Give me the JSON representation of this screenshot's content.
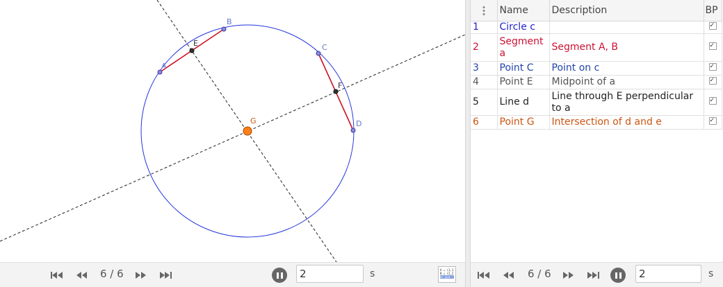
{
  "colors": {
    "blue": "#2222cc",
    "red": "#cc1133",
    "navy": "#2244aa",
    "gray": "#555555",
    "black": "#222222",
    "orange": "#cc5511",
    "circle": "#2233dd",
    "segment": "#cc1122",
    "point_g": "#ff7f1a"
  },
  "graphics": {
    "labels": {
      "A": "A",
      "B": "B",
      "C": "C",
      "D": "D",
      "E": "E",
      "F": "F",
      "G": "G"
    }
  },
  "protocol": {
    "headers": {
      "num": "",
      "name": "Name",
      "description": "Description",
      "bp": "BP"
    },
    "rows": [
      {
        "num": "1",
        "name": "Circle c",
        "description": "",
        "bp": true,
        "color": "#2222cc"
      },
      {
        "num": "2",
        "name": "Segment a",
        "description": "Segment A, B",
        "bp": true,
        "color": "#cc1133"
      },
      {
        "num": "3",
        "name": "Point C",
        "description": "Point on c",
        "bp": true,
        "color": "#2244aa"
      },
      {
        "num": "4",
        "name": "Point E",
        "description": "Midpoint of a",
        "bp": true,
        "color": "#555555"
      },
      {
        "num": "5",
        "name": "Line d",
        "description": "Line through E perpendicular to a",
        "bp": true,
        "color": "#222222"
      },
      {
        "num": "6",
        "name": "Point G",
        "description": "Intersection of d and e",
        "bp": true,
        "color": "#cc5511"
      }
    ]
  },
  "nav_left": {
    "step": "6 / 6",
    "speed": "2",
    "unit": "s",
    "algebra_icon": [
      "A = (1,1)",
      "B = (2,2)",
      "a: y=x"
    ]
  },
  "nav_right": {
    "step": "6 / 6",
    "speed": "2",
    "unit": "s"
  },
  "icons": [
    "first-icon",
    "previous-icon",
    "next-icon",
    "last-icon",
    "pause-icon",
    "menu-dots-icon",
    "checkbox-icon",
    "algebra-view-icon"
  ]
}
